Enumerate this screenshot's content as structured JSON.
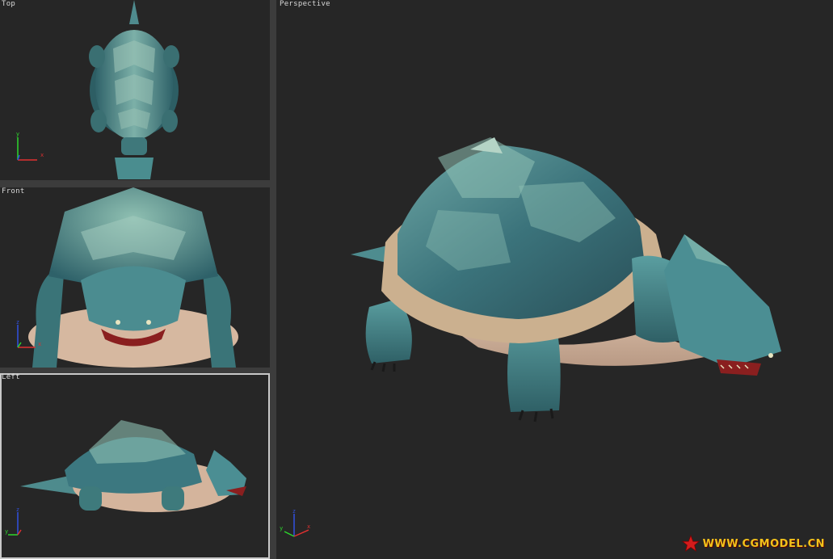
{
  "viewports": {
    "top": {
      "label": "Top"
    },
    "front": {
      "label": "Front"
    },
    "left": {
      "label": "Left"
    },
    "perspective": {
      "label": "Perspective"
    }
  },
  "axis_labels": {
    "x": "x",
    "y": "y",
    "z": "z"
  },
  "model": {
    "icon": "snapping-turtle-model",
    "colors": {
      "shell": "#3f7f86",
      "skin": "#4c8f93",
      "belly": "#d8b9a1",
      "mouth": "#8a1f1f",
      "background": "#262626"
    }
  },
  "watermark": {
    "text": "WWW.CGMODEL.CN",
    "icon": "red-star-icon",
    "color": "#f2c21b"
  }
}
